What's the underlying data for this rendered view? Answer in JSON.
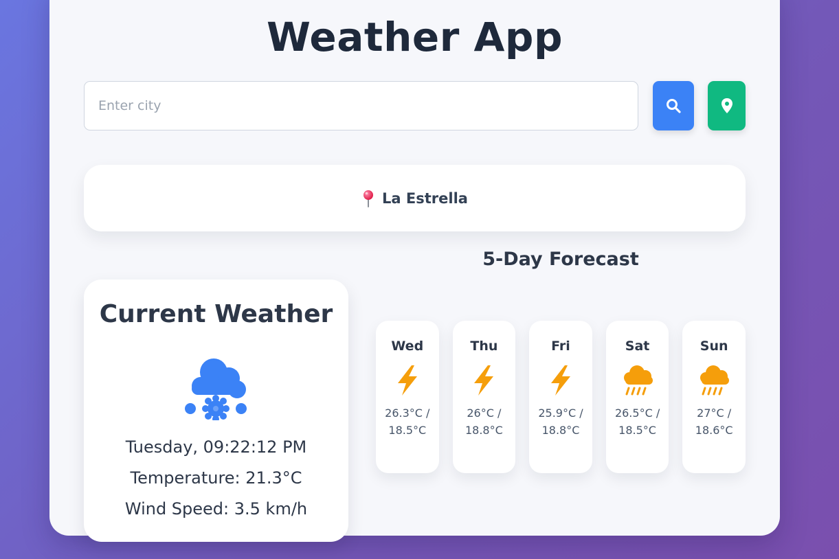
{
  "app": {
    "title": "Weather App"
  },
  "search": {
    "placeholder": "Enter city",
    "value": ""
  },
  "buttons": {
    "search_icon": "search-icon",
    "location_icon": "map-pin-icon"
  },
  "location": {
    "pin_icon": "round-pushpin-icon",
    "name": "La Estrella"
  },
  "current": {
    "title": "Current Weather",
    "icon": "snow-cloud-icon",
    "datetime": "Tuesday, 09:22:12 PM",
    "temperature": "Temperature: 21.3°C",
    "wind": "Wind Speed: 3.5 km/h"
  },
  "forecast": {
    "title": "5-Day Forecast",
    "days": [
      {
        "day": "Wed",
        "icon": "lightning-icon",
        "temp": "26.3°C / 18.5°C"
      },
      {
        "day": "Thu",
        "icon": "lightning-icon",
        "temp": "26°C / 18.8°C"
      },
      {
        "day": "Fri",
        "icon": "lightning-icon",
        "temp": "25.9°C / 18.8°C"
      },
      {
        "day": "Sat",
        "icon": "rain-cloud-icon",
        "temp": "26.5°C / 18.5°C"
      },
      {
        "day": "Sun",
        "icon": "rain-cloud-icon",
        "temp": "27°C / 18.6°C"
      }
    ]
  },
  "colors": {
    "search_button": "#3b82f6",
    "location_button": "#10b981",
    "current_icon": "#3b82f6",
    "lightning": "#f59e0b",
    "rain": "#f59e0b",
    "title_text": "#1e293b"
  }
}
